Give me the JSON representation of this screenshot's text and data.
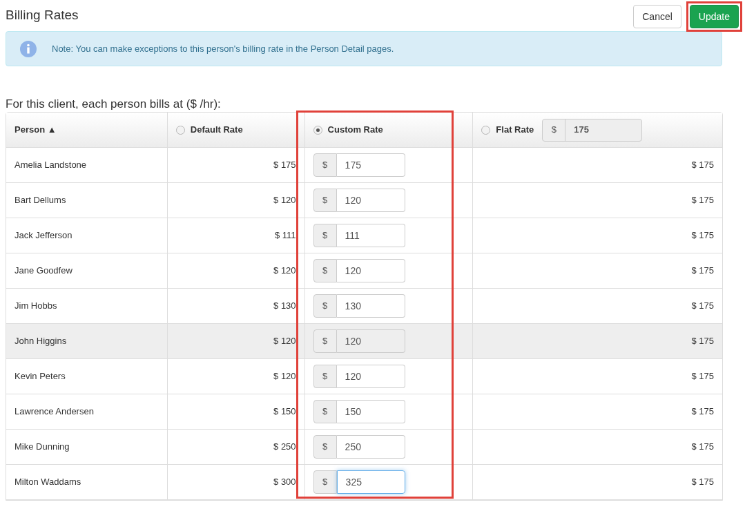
{
  "title": "Billing Rates",
  "buttons": [
    {
      "label": "Cancel",
      "kind": "default",
      "highlighted": false
    },
    {
      "label": "Update",
      "kind": "primary",
      "highlighted": true
    }
  ],
  "note": "Note: You can make exceptions to this person's billing rate in the Person Detail pages.",
  "subtitle": "For this client, each person bills at ($ /hr):",
  "table": {
    "columns": [
      {
        "label": "Person ▲",
        "kind": "sort"
      },
      {
        "label": "Default Rate",
        "kind": "radio",
        "selected": false,
        "highlighted": false
      },
      {
        "label": "Custom Rate",
        "kind": "radio",
        "selected": true,
        "highlighted": true
      },
      {
        "label": "Flat Rate",
        "kind": "flat",
        "selected": false,
        "highlighted": false,
        "addon": "$",
        "value": "175"
      }
    ],
    "rows": [
      {
        "person": "Amelia Landstone",
        "default_rate": "$ 175",
        "addon": "$",
        "custom_rate": "175",
        "flat_rate": "$ 175",
        "hovered": false,
        "focused": false
      },
      {
        "person": "Bart Dellums",
        "default_rate": "$ 120",
        "addon": "$",
        "custom_rate": "120",
        "flat_rate": "$ 175",
        "hovered": false,
        "focused": false
      },
      {
        "person": "Jack Jefferson",
        "default_rate": "$ 111",
        "addon": "$",
        "custom_rate": "111",
        "flat_rate": "$ 175",
        "hovered": false,
        "focused": false
      },
      {
        "person": "Jane Goodfew",
        "default_rate": "$ 120",
        "addon": "$",
        "custom_rate": "120",
        "flat_rate": "$ 175",
        "hovered": false,
        "focused": false
      },
      {
        "person": "Jim Hobbs",
        "default_rate": "$ 130",
        "addon": "$",
        "custom_rate": "130",
        "flat_rate": "$ 175",
        "hovered": false,
        "focused": false
      },
      {
        "person": "John Higgins",
        "default_rate": "$ 120",
        "addon": "$",
        "custom_rate": "120",
        "flat_rate": "$ 175",
        "hovered": true,
        "focused": false
      },
      {
        "person": "Kevin Peters",
        "default_rate": "$ 120",
        "addon": "$",
        "custom_rate": "120",
        "flat_rate": "$ 175",
        "hovered": false,
        "focused": false
      },
      {
        "person": "Lawrence Andersen",
        "default_rate": "$ 150",
        "addon": "$",
        "custom_rate": "150",
        "flat_rate": "$ 175",
        "hovered": false,
        "focused": false
      },
      {
        "person": "Mike Dunning",
        "default_rate": "$ 250",
        "addon": "$",
        "custom_rate": "250",
        "flat_rate": "$ 175",
        "hovered": false,
        "focused": false
      },
      {
        "person": "Milton Waddams",
        "default_rate": "$ 300",
        "addon": "$",
        "custom_rate": "325",
        "flat_rate": "$ 175",
        "hovered": false,
        "focused": true
      }
    ]
  }
}
